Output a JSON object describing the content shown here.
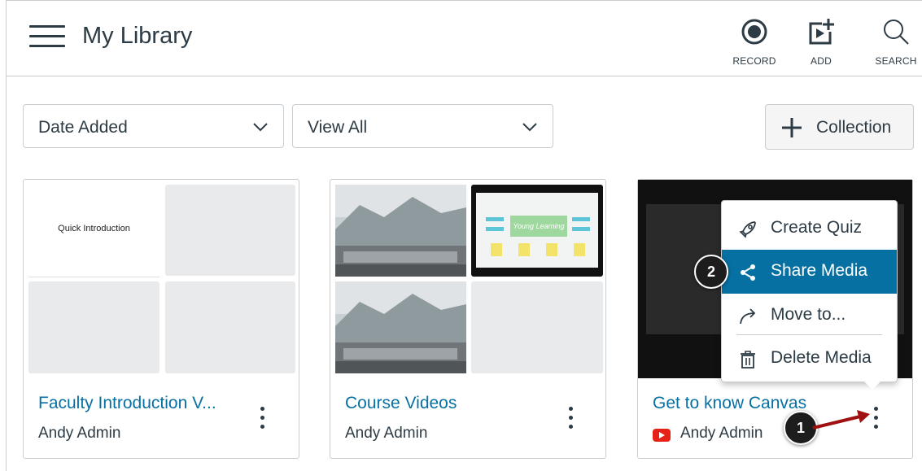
{
  "header": {
    "title": "My Library",
    "record_label": "RECORD",
    "add_label": "ADD",
    "search_label": "SEARCH"
  },
  "filters": {
    "sort_value": "Date Added",
    "view_value": "View All",
    "collection_label": "Collection"
  },
  "cards": [
    {
      "title": "Faculty Introduction V...",
      "author": "Andy Admin",
      "thumb_text": "Quick Introduction"
    },
    {
      "title": "Course Videos",
      "author": "Andy Admin",
      "slide_text": "Young Learning"
    },
    {
      "title": "Get to know Canvas",
      "author": "Andy Admin",
      "source_icon": "youtube-icon"
    }
  ],
  "menu": {
    "items": [
      "Create Quiz",
      "Share Media",
      "Move to...",
      "Delete Media"
    ],
    "active_index": 1
  },
  "callouts": [
    "1",
    "2"
  ],
  "colors": {
    "link": "#0770a3",
    "active_menu": "#0770a3",
    "text": "#2d3b45",
    "arrow": "#a01010",
    "youtube": "#e62117"
  }
}
